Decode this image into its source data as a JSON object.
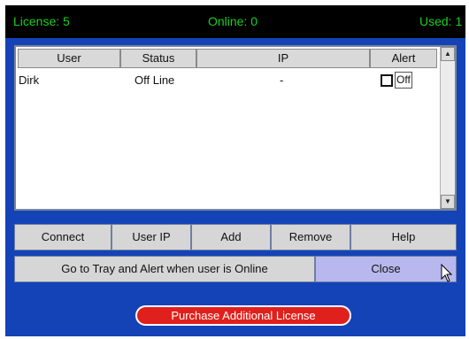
{
  "topbar": {
    "license": "License: 5",
    "online": "Online: 0",
    "used": "Used: 1"
  },
  "table": {
    "columns": [
      "User",
      "Status",
      "IP",
      "Alert"
    ],
    "rows": [
      {
        "user": "Dirk",
        "status": "Off Line",
        "ip": "-",
        "alert_checked": false,
        "alert_value": "Off"
      }
    ]
  },
  "buttons": {
    "connect": "Connect",
    "user_ip": "User IP",
    "add": "Add",
    "remove": "Remove",
    "help": "Help",
    "tray": "Go to Tray and Alert when user is Online",
    "close": "Close",
    "purchase": "Purchase Additional License"
  },
  "colors": {
    "background": "#1443b8",
    "topbar_text": "#16d11f",
    "purchase": "#e0201c",
    "close_button": "#b8b8ee"
  },
  "icons": {
    "scroll_up": "scroll-up-arrow-icon",
    "scroll_down": "scroll-down-arrow-icon",
    "cursor": "mouse-cursor-icon"
  }
}
